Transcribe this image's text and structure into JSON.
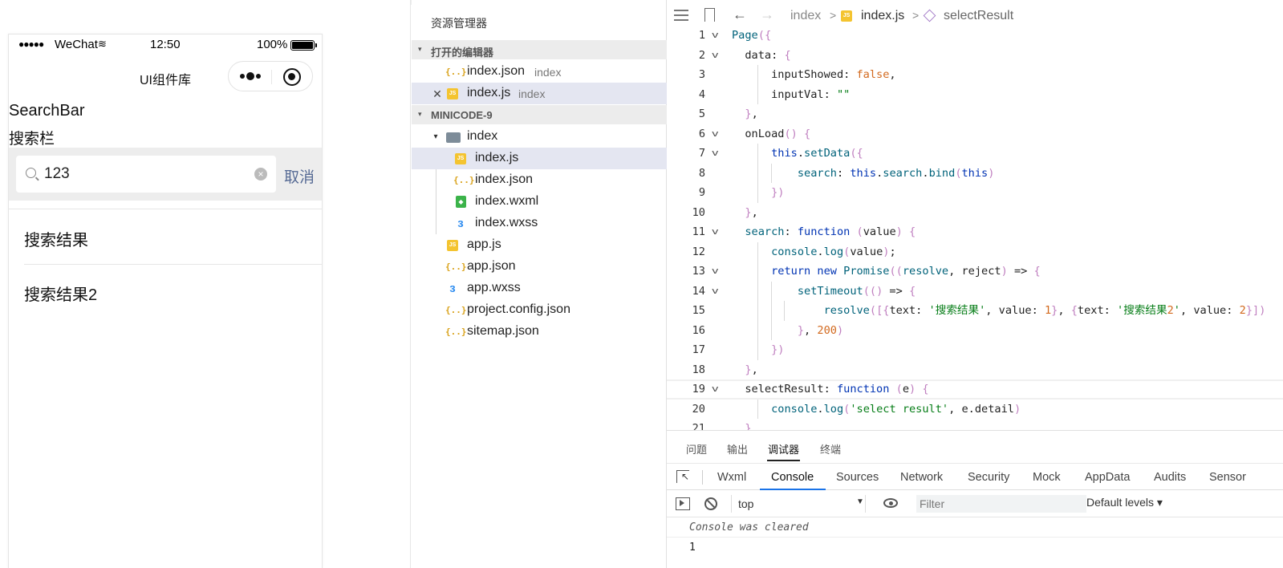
{
  "simulator": {
    "status": {
      "signal": "●●●●●",
      "carrier": "WeChat",
      "wifi": "≋",
      "time": "12:50",
      "battery": "100%",
      "battery_level": 1.0
    },
    "navbar": {
      "title": "UI组件库"
    },
    "page": {
      "title": "SearchBar",
      "desc": "搜索栏"
    },
    "search": {
      "value": "123",
      "cancel": "取消",
      "clear": "×"
    },
    "results": [
      "搜索结果",
      "搜索结果2"
    ]
  },
  "explorer": {
    "title": "资源管理器",
    "open_editors": {
      "label": "打开的编辑器",
      "items": [
        {
          "name": "index.json",
          "hint": "index",
          "type": "json"
        },
        {
          "name": "index.js",
          "hint": "index",
          "type": "js",
          "active": true
        }
      ]
    },
    "project": {
      "label": "MINICODE-9",
      "folder": "index",
      "folder_items": [
        {
          "name": "index.js",
          "type": "js",
          "selected": true
        },
        {
          "name": "index.json",
          "type": "json"
        },
        {
          "name": "index.wxml",
          "type": "wxml"
        },
        {
          "name": "index.wxss",
          "type": "wxss"
        }
      ],
      "root_items": [
        {
          "name": "app.js",
          "type": "js"
        },
        {
          "name": "app.json",
          "type": "json"
        },
        {
          "name": "app.wxss",
          "type": "wxss"
        },
        {
          "name": "project.config.json",
          "type": "json"
        },
        {
          "name": "sitemap.json",
          "type": "json"
        }
      ]
    },
    "icons": {
      "json": "{..}",
      "js": "JS",
      "wxml": "◆",
      "wxss": "ᴈ",
      "close": "✕",
      "expanded": "▾"
    }
  },
  "editor": {
    "breadcrumb": {
      "folder": "index",
      "file": "index.js",
      "symbol": "selectResult",
      "sep": ">",
      "back": "←",
      "forward": "→"
    },
    "code_lines": [
      "Page({",
      "  data: {",
      "      inputShowed: false,",
      "      inputVal: \"\"",
      "  },",
      "  onLoad() {",
      "      this.setData({",
      "          search: this.search.bind(this)",
      "      })",
      "  },",
      "  search: function (value) {",
      "      console.log(value);",
      "      return new Promise((resolve, reject) => {",
      "          setTimeout(() => {",
      "              resolve([{text: '搜索结果', value: 1}, {text: '搜索结果2', value: 2}])",
      "          }, 200)",
      "      })",
      "  },",
      "  selectResult: function (e) {",
      "      console.log('select result', e.detail)",
      "  },"
    ]
  },
  "panel": {
    "tabs": [
      "问题",
      "输出",
      "调试器",
      "终端"
    ],
    "devtools_tabs": [
      "Wxml",
      "Console",
      "Sources",
      "Network",
      "Security",
      "Mock",
      "AppData",
      "Audits",
      "Sensor"
    ],
    "context": "top",
    "filter_placeholder": "Filter",
    "levels": "Default levels ▾",
    "console_cleared": "Console was cleared",
    "output": "1"
  }
}
